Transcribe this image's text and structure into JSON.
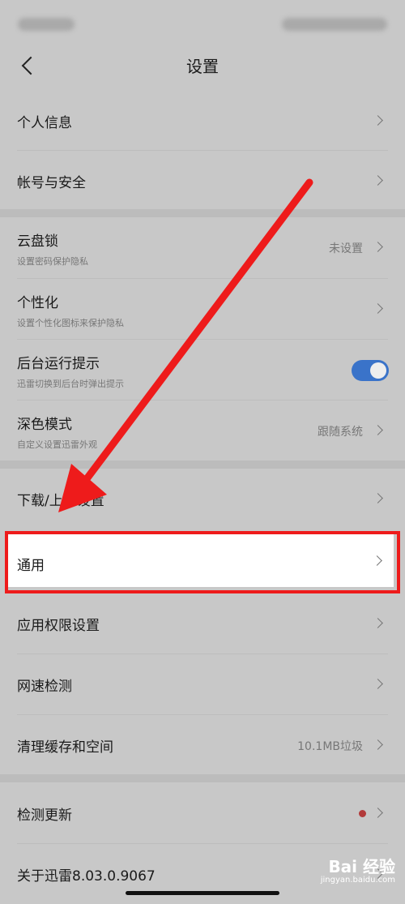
{
  "header": {
    "title": "设置"
  },
  "rows": {
    "profile": {
      "title": "个人信息"
    },
    "account": {
      "title": "帐号与安全"
    },
    "cloud_lock": {
      "title": "云盘锁",
      "sub": "设置密码保护隐私",
      "value": "未设置"
    },
    "personalize": {
      "title": "个性化",
      "sub": "设置个性化图标来保护隐私"
    },
    "background": {
      "title": "后台运行提示",
      "sub": "迅雷切换到后台时弹出提示",
      "toggle_on": true
    },
    "dark_mode": {
      "title": "深色模式",
      "sub": "自定义设置迅雷外观",
      "value": "跟随系统"
    },
    "download_upload": {
      "title": "下载/上传设置"
    },
    "general": {
      "title": "通用"
    },
    "permissions": {
      "title": "应用权限设置"
    },
    "speed_test": {
      "title": "网速检测"
    },
    "cache": {
      "title": "清理缓存和空间",
      "value": "10.1MB垃圾"
    },
    "update": {
      "title": "检测更新"
    },
    "about": {
      "title": "关于迅雷8.03.0.9067"
    }
  },
  "watermark": {
    "brand": "Bai 经验",
    "url": "jingyan.baidu.com"
  },
  "colors": {
    "toggle_on": "#3a73c9",
    "annotation_red": "#ee1b1b",
    "update_dot": "#b23a3a"
  }
}
